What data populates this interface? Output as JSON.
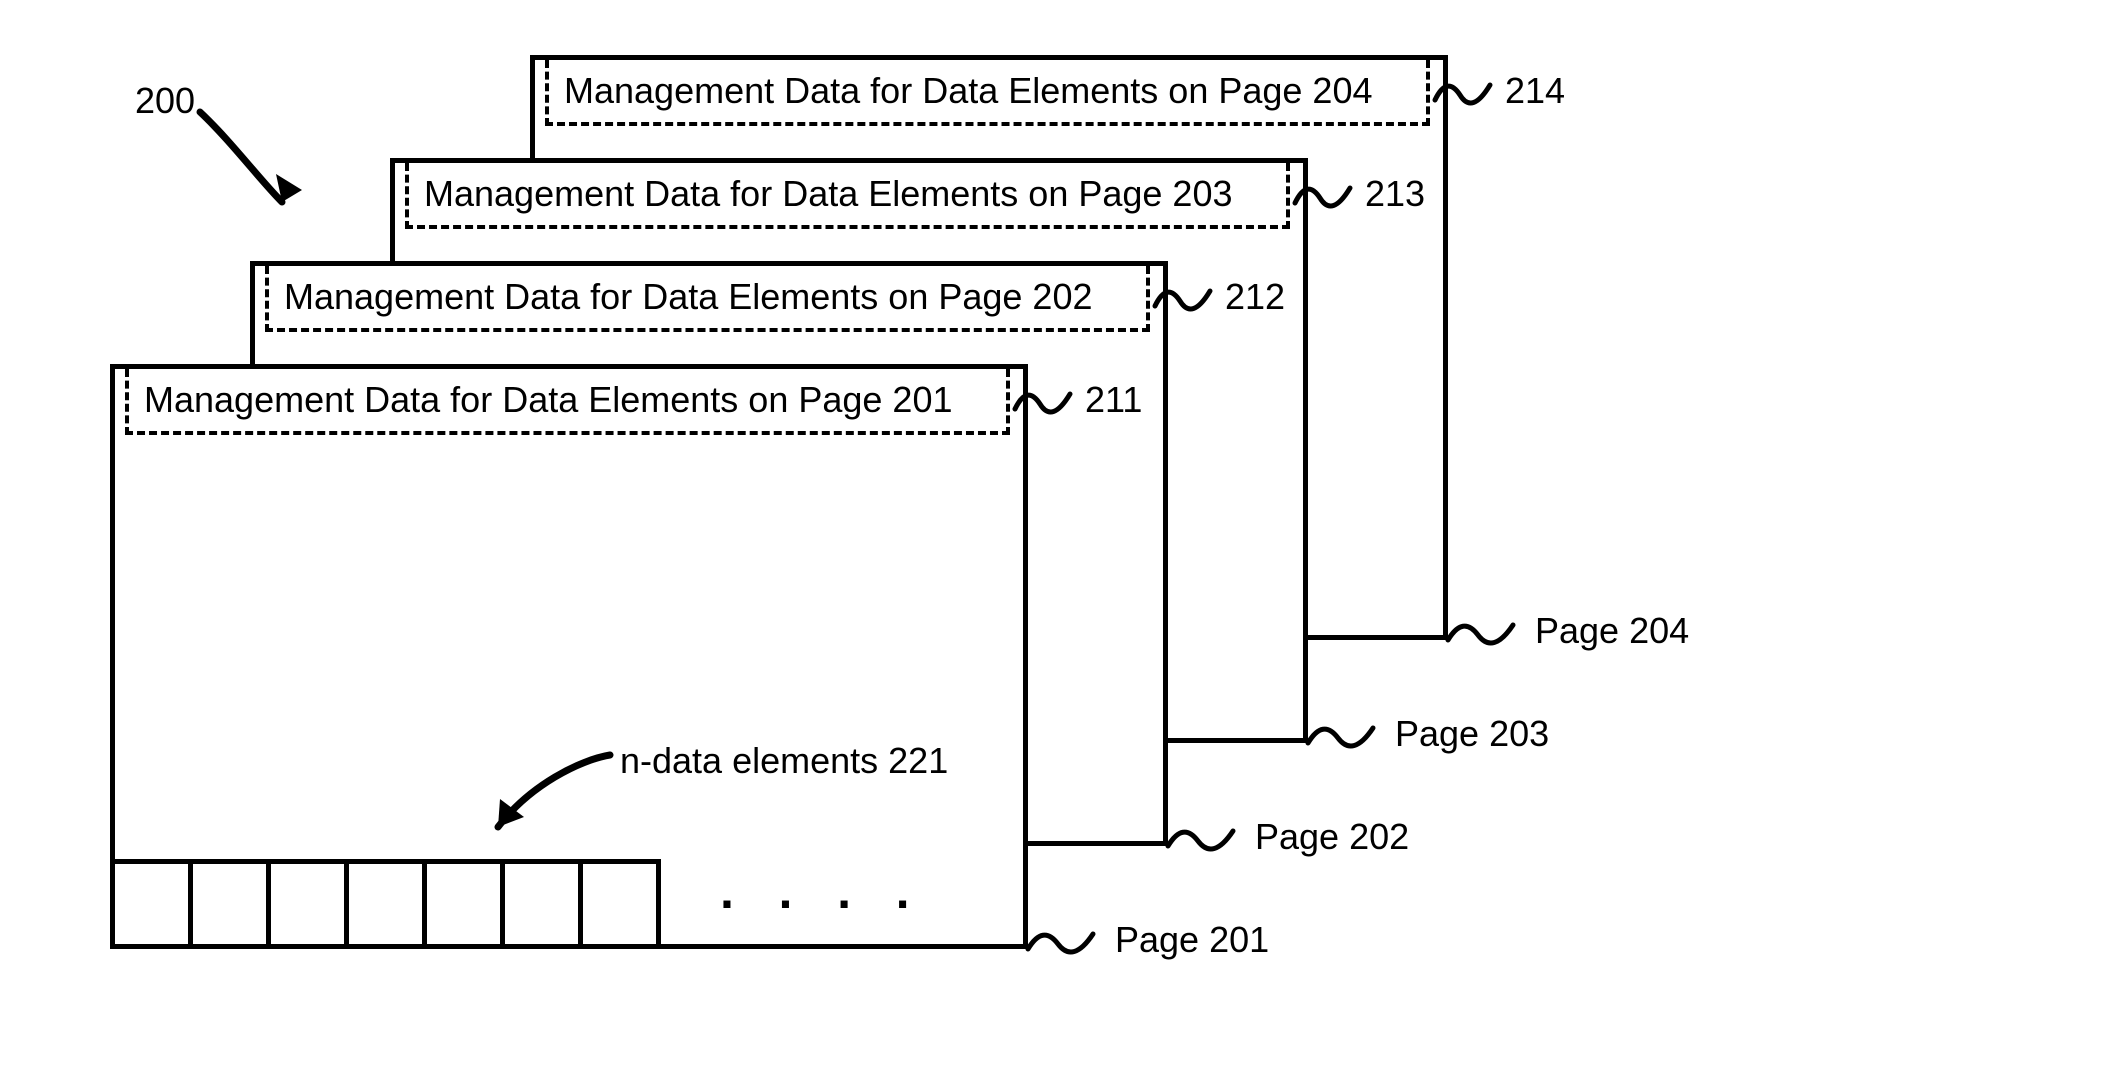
{
  "figureRef": "200",
  "pages": [
    {
      "mgmt": "Management Data for Data Elements on Page 201",
      "mgmtRef": "211",
      "pageLabel": "Page 201"
    },
    {
      "mgmt": "Management Data for Data Elements on Page 202",
      "mgmtRef": "212",
      "pageLabel": "Page 202"
    },
    {
      "mgmt": "Management Data for Data Elements on Page 203",
      "mgmtRef": "213",
      "pageLabel": "Page 203"
    },
    {
      "mgmt": "Management Data for Data Elements on Page 204",
      "mgmtRef": "214",
      "pageLabel": "Page 204"
    }
  ],
  "dataElements": {
    "label": "n-data elements 221",
    "dots": "· · · ·"
  }
}
